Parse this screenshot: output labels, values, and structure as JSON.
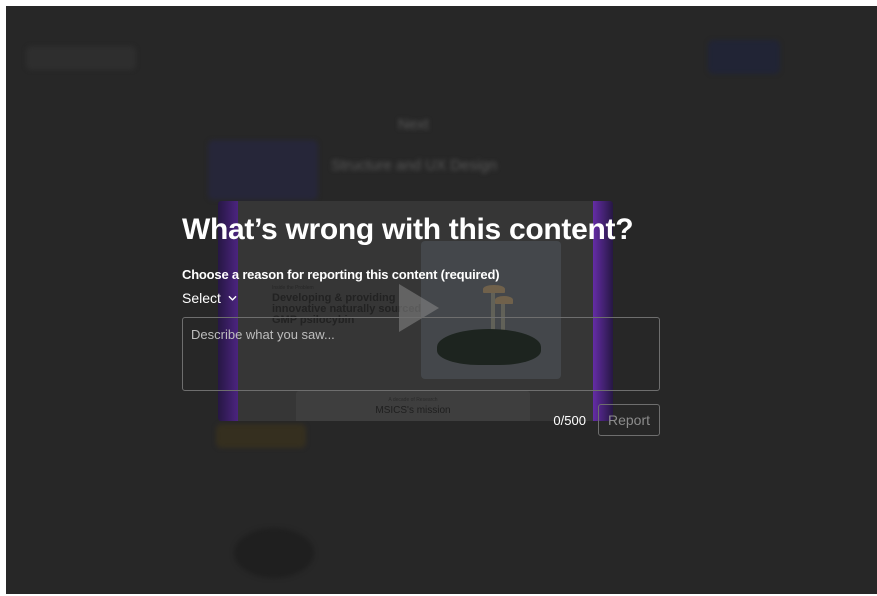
{
  "background": {
    "next_label": "Next",
    "item_title": "Structure and UX Design"
  },
  "video": {
    "small_caption": "Inside the Problem",
    "heading": "Developing & providing innovative naturally sourced GMP psilocybin",
    "mission_small": "A decade of Research",
    "mission": "MSICS's mission",
    "play_icon": "play-icon"
  },
  "modal": {
    "title": "What’s wrong with this content?",
    "reason_label": "Choose a reason for reporting this content (required)",
    "select_value": "Select",
    "select_icon": "chevron-down-icon",
    "description_placeholder": "Describe what you saw...",
    "description_value": "",
    "char_count": "0/500",
    "report_label": "Report"
  },
  "colors": {
    "backdrop": "#2b2b2b",
    "text": "#ffffff",
    "border": "#6e6e6e",
    "disabled_text": "#8c8c8c",
    "accent_purple": "#7a35c8"
  }
}
